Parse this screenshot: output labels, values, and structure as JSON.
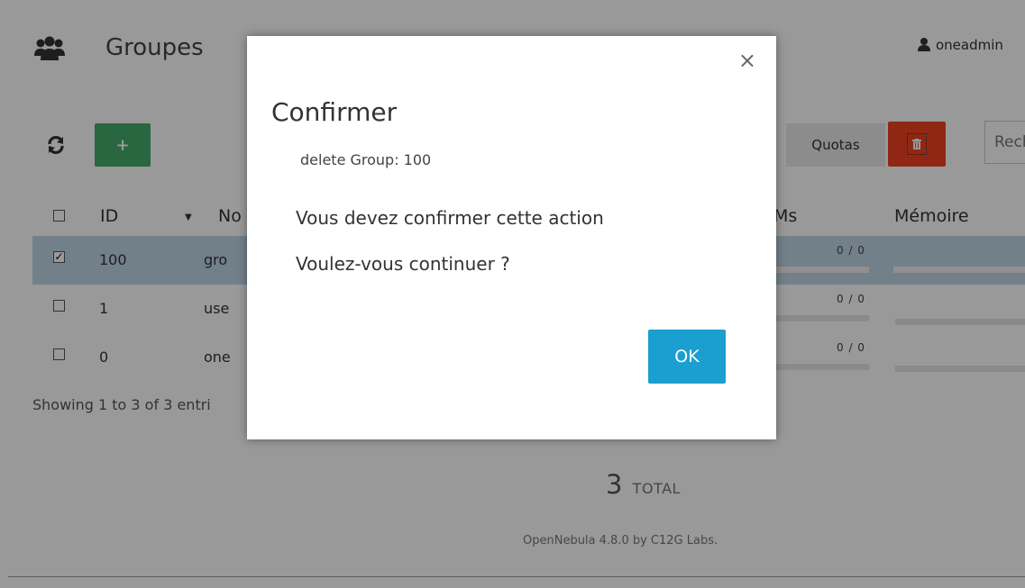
{
  "header": {
    "title": "Groupes",
    "groups_icon": "users-icon",
    "user_icon": "user-icon",
    "username": "oneadmin"
  },
  "toolbar": {
    "refresh_icon": "refresh-icon",
    "add_label": "+",
    "quotas_label": "Quotas",
    "delete_icon": "trash-icon",
    "search_placeholder": "Rech"
  },
  "table": {
    "columns": [
      "ID",
      "No",
      "Ms",
      "Mémoire"
    ],
    "rows": [
      {
        "id": "100",
        "name": "gro",
        "checked": true,
        "vms": "0 / 0",
        "vms_fill": 0,
        "memory_fill": 0
      },
      {
        "id": "1",
        "name": "use",
        "checked": false,
        "vms": "0 / 0",
        "vms_fill": 0,
        "memory_fill": 0
      },
      {
        "id": "0",
        "name": "one",
        "checked": false,
        "vms": "0 / 0",
        "vms_fill": 0,
        "memory_fill": 0
      }
    ],
    "showing": "Showing 1 to 3 of 3 entri"
  },
  "summary": {
    "total_count": "3",
    "total_label": "TOTAL"
  },
  "footer": {
    "text": "OpenNebula 4.8.0 by C12G Labs."
  },
  "modal": {
    "title": "Confirmer",
    "subtitle": "delete Group: 100",
    "line1": "Vous devez confirmer cette action",
    "line2": "Voulez-vous continuer ?",
    "ok_label": "OK",
    "close_glyph": "×",
    "close_icon": "close-icon"
  },
  "colors": {
    "add_button": "#43ac6a",
    "delete_button": "#f04124",
    "ok_button": "#1a9fd0",
    "selected_row": "#bfd6e6"
  }
}
